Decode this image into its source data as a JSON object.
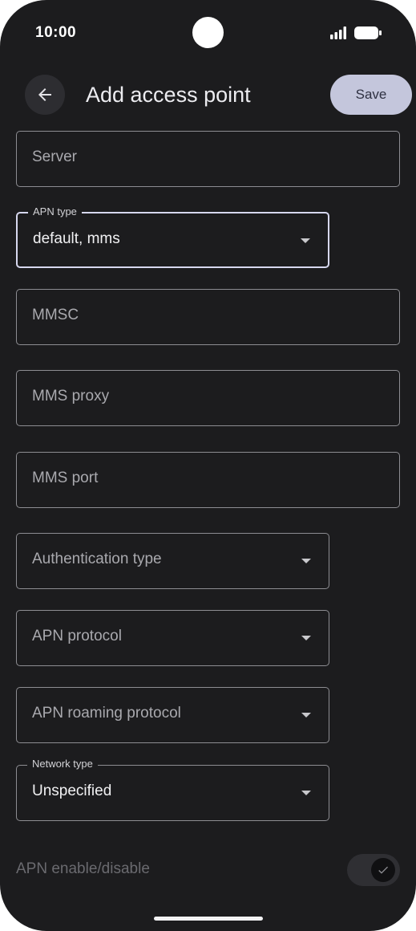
{
  "status_bar": {
    "time": "10:00",
    "icons": [
      "signal-icon",
      "battery-icon"
    ]
  },
  "header": {
    "back_icon": "arrow-left-icon",
    "title": "Add access point",
    "save_label": "Save"
  },
  "fields": {
    "server": {
      "label": "Server",
      "value": ""
    },
    "apn_type": {
      "label": "APN type",
      "value": "default, mms"
    },
    "mmsc": {
      "label": "MMSC",
      "value": ""
    },
    "mms_proxy": {
      "label": "MMS proxy",
      "value": ""
    },
    "mms_port": {
      "label": "MMS port",
      "value": ""
    },
    "authentication_type": {
      "label": "Authentication type",
      "value": ""
    },
    "apn_protocol": {
      "label": "APN protocol",
      "value": ""
    },
    "apn_roaming_protocol": {
      "label": "APN roaming protocol",
      "value": ""
    },
    "network_type": {
      "label": "Network type",
      "value": "Unspecified"
    }
  },
  "apn_toggle": {
    "label": "APN enable/disable",
    "checked": true,
    "enabled": false
  },
  "colors": {
    "background": "#1c1c1e",
    "save_button": "#c4c6dc",
    "field_border": "#8d8d92",
    "focused_border": "#d6d7ee"
  }
}
